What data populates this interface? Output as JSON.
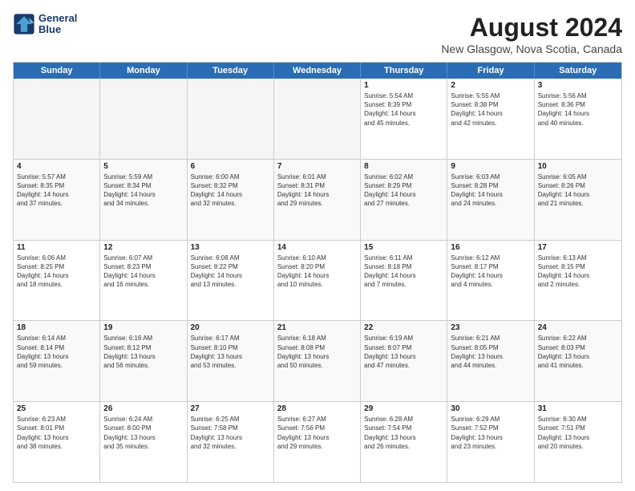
{
  "logo": {
    "line1": "General",
    "line2": "Blue"
  },
  "title": "August 2024",
  "subtitle": "New Glasgow, Nova Scotia, Canada",
  "headers": [
    "Sunday",
    "Monday",
    "Tuesday",
    "Wednesday",
    "Thursday",
    "Friday",
    "Saturday"
  ],
  "weeks": [
    [
      {
        "day": "",
        "info": "",
        "empty": true
      },
      {
        "day": "",
        "info": "",
        "empty": true
      },
      {
        "day": "",
        "info": "",
        "empty": true
      },
      {
        "day": "",
        "info": "",
        "empty": true
      },
      {
        "day": "1",
        "info": "Sunrise: 5:54 AM\nSunset: 8:39 PM\nDaylight: 14 hours\nand 45 minutes."
      },
      {
        "day": "2",
        "info": "Sunrise: 5:55 AM\nSunset: 8:38 PM\nDaylight: 14 hours\nand 42 minutes."
      },
      {
        "day": "3",
        "info": "Sunrise: 5:56 AM\nSunset: 8:36 PM\nDaylight: 14 hours\nand 40 minutes."
      }
    ],
    [
      {
        "day": "4",
        "info": "Sunrise: 5:57 AM\nSunset: 8:35 PM\nDaylight: 14 hours\nand 37 minutes."
      },
      {
        "day": "5",
        "info": "Sunrise: 5:59 AM\nSunset: 8:34 PM\nDaylight: 14 hours\nand 34 minutes."
      },
      {
        "day": "6",
        "info": "Sunrise: 6:00 AM\nSunset: 8:32 PM\nDaylight: 14 hours\nand 32 minutes."
      },
      {
        "day": "7",
        "info": "Sunrise: 6:01 AM\nSunset: 8:31 PM\nDaylight: 14 hours\nand 29 minutes."
      },
      {
        "day": "8",
        "info": "Sunrise: 6:02 AM\nSunset: 8:29 PM\nDaylight: 14 hours\nand 27 minutes."
      },
      {
        "day": "9",
        "info": "Sunrise: 6:03 AM\nSunset: 8:28 PM\nDaylight: 14 hours\nand 24 minutes."
      },
      {
        "day": "10",
        "info": "Sunrise: 6:05 AM\nSunset: 8:26 PM\nDaylight: 14 hours\nand 21 minutes."
      }
    ],
    [
      {
        "day": "11",
        "info": "Sunrise: 6:06 AM\nSunset: 8:25 PM\nDaylight: 14 hours\nand 18 minutes."
      },
      {
        "day": "12",
        "info": "Sunrise: 6:07 AM\nSunset: 8:23 PM\nDaylight: 14 hours\nand 16 minutes."
      },
      {
        "day": "13",
        "info": "Sunrise: 6:08 AM\nSunset: 8:22 PM\nDaylight: 14 hours\nand 13 minutes."
      },
      {
        "day": "14",
        "info": "Sunrise: 6:10 AM\nSunset: 8:20 PM\nDaylight: 14 hours\nand 10 minutes."
      },
      {
        "day": "15",
        "info": "Sunrise: 6:11 AM\nSunset: 8:18 PM\nDaylight: 14 hours\nand 7 minutes."
      },
      {
        "day": "16",
        "info": "Sunrise: 6:12 AM\nSunset: 8:17 PM\nDaylight: 14 hours\nand 4 minutes."
      },
      {
        "day": "17",
        "info": "Sunrise: 6:13 AM\nSunset: 8:15 PM\nDaylight: 14 hours\nand 2 minutes."
      }
    ],
    [
      {
        "day": "18",
        "info": "Sunrise: 6:14 AM\nSunset: 8:14 PM\nDaylight: 13 hours\nand 59 minutes."
      },
      {
        "day": "19",
        "info": "Sunrise: 6:16 AM\nSunset: 8:12 PM\nDaylight: 13 hours\nand 56 minutes."
      },
      {
        "day": "20",
        "info": "Sunrise: 6:17 AM\nSunset: 8:10 PM\nDaylight: 13 hours\nand 53 minutes."
      },
      {
        "day": "21",
        "info": "Sunrise: 6:18 AM\nSunset: 8:08 PM\nDaylight: 13 hours\nand 50 minutes."
      },
      {
        "day": "22",
        "info": "Sunrise: 6:19 AM\nSunset: 8:07 PM\nDaylight: 13 hours\nand 47 minutes."
      },
      {
        "day": "23",
        "info": "Sunrise: 6:21 AM\nSunset: 8:05 PM\nDaylight: 13 hours\nand 44 minutes."
      },
      {
        "day": "24",
        "info": "Sunrise: 6:22 AM\nSunset: 8:03 PM\nDaylight: 13 hours\nand 41 minutes."
      }
    ],
    [
      {
        "day": "25",
        "info": "Sunrise: 6:23 AM\nSunset: 8:01 PM\nDaylight: 13 hours\nand 38 minutes."
      },
      {
        "day": "26",
        "info": "Sunrise: 6:24 AM\nSunset: 8:00 PM\nDaylight: 13 hours\nand 35 minutes."
      },
      {
        "day": "27",
        "info": "Sunrise: 6:25 AM\nSunset: 7:58 PM\nDaylight: 13 hours\nand 32 minutes."
      },
      {
        "day": "28",
        "info": "Sunrise: 6:27 AM\nSunset: 7:56 PM\nDaylight: 13 hours\nand 29 minutes."
      },
      {
        "day": "29",
        "info": "Sunrise: 6:28 AM\nSunset: 7:54 PM\nDaylight: 13 hours\nand 26 minutes."
      },
      {
        "day": "30",
        "info": "Sunrise: 6:29 AM\nSunset: 7:52 PM\nDaylight: 13 hours\nand 23 minutes."
      },
      {
        "day": "31",
        "info": "Sunrise: 6:30 AM\nSunset: 7:51 PM\nDaylight: 13 hours\nand 20 minutes."
      }
    ]
  ]
}
